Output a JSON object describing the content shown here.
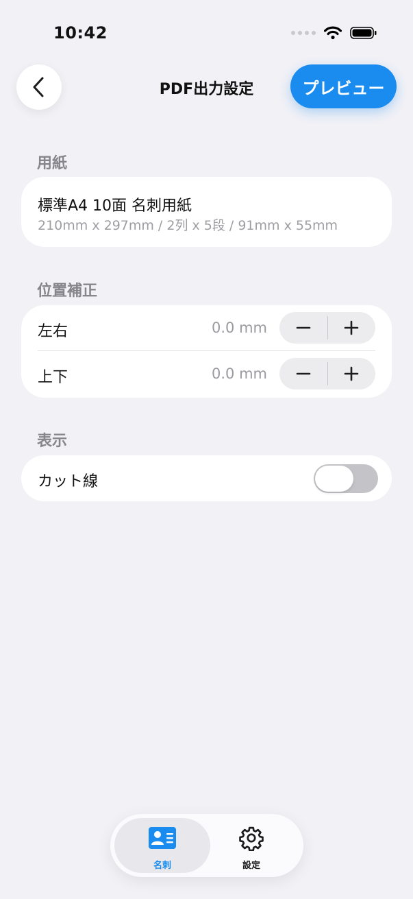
{
  "status": {
    "time": "10:42"
  },
  "nav": {
    "title": "PDF出力設定",
    "preview_label": "プレビュー"
  },
  "paper": {
    "section_label": "用紙",
    "name": "標準A4 10面 名刺用紙",
    "detail": "210mm x 297mm / 2列 x 5段 / 91mm x 55mm"
  },
  "position": {
    "section_label": "位置補正",
    "rows": [
      {
        "label": "左右",
        "value": "0.0 mm"
      },
      {
        "label": "上下",
        "value": "0.0 mm"
      }
    ]
  },
  "display": {
    "section_label": "表示",
    "cut_line_label": "カット線",
    "cut_line_on": false
  },
  "tabs": [
    {
      "label": "名刺",
      "icon": "contact-card-icon",
      "active": true
    },
    {
      "label": "設定",
      "icon": "gear-icon",
      "active": false
    }
  ],
  "colors": {
    "accent": "#1a8cf0",
    "background": "#f1f1f6"
  }
}
